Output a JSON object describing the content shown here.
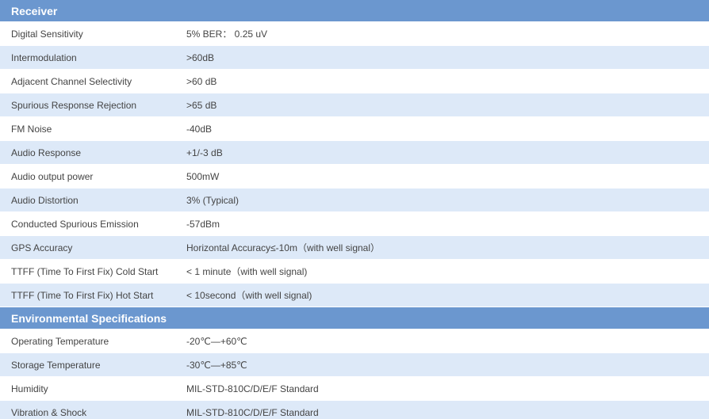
{
  "sections": [
    {
      "title": "Receiver",
      "rows": [
        {
          "label": "Digital Sensitivity",
          "value": "5% BER： 0.25 uV"
        },
        {
          "label": "Intermodulation",
          "value": ">60dB"
        },
        {
          "label": "Adjacent Channel Selectivity",
          "value": ">60 dB"
        },
        {
          "label": "Spurious Response Rejection",
          "value": ">65 dB"
        },
        {
          "label": "FM Noise",
          "value": "-40dB"
        },
        {
          "label": "Audio Response",
          "value": "+1/-3 dB"
        },
        {
          "label": "Audio output power",
          "value": "500mW"
        },
        {
          "label": "Audio Distortion",
          "value": "3% (Typical)"
        },
        {
          "label": "Conducted Spurious Emission",
          "value": "-57dBm"
        },
        {
          "label": "GPS Accuracy",
          "value": "Horizontal Accuracy≤-10m（with well signal）"
        },
        {
          "label": "TTFF (Time To First Fix) Cold Start",
          "value": "< 1 minute（with well signal)"
        },
        {
          "label": "TTFF (Time To First Fix) Hot Start",
          "value": "< 10second（with well signal)"
        }
      ]
    },
    {
      "title": "Environmental Specifications",
      "rows": [
        {
          "label": "Operating Temperature",
          "value": "-20℃—+60℃"
        },
        {
          "label": "Storage Temperature",
          "value": "-30℃—+85℃"
        },
        {
          "label": "Humidity",
          "value": "MIL-STD-810C/D/E/F Standard"
        },
        {
          "label": "Vibration & Shock",
          "value": "MIL-STD-810C/D/E/F Standard"
        }
      ]
    }
  ]
}
